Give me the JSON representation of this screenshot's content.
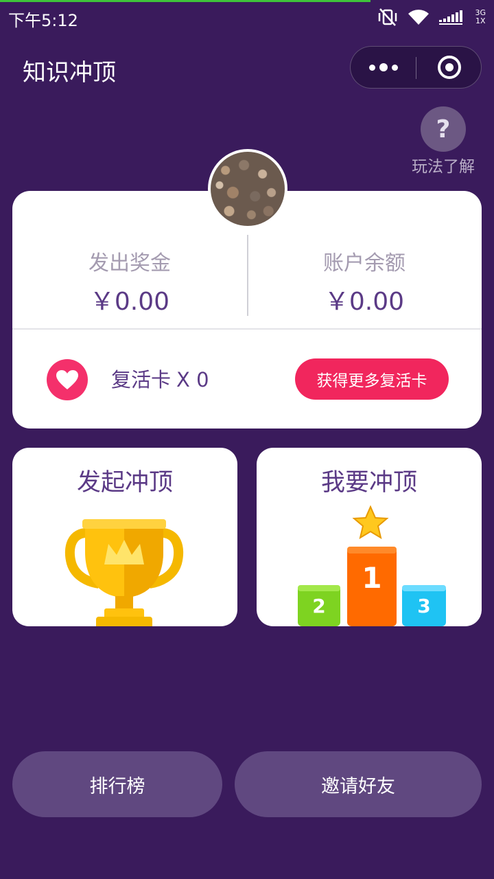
{
  "status_bar": {
    "time": "下午5:12",
    "network_top": "3G",
    "network_bottom": "1X"
  },
  "nav": {
    "title": "知识冲顶"
  },
  "help": {
    "label": "玩法了解"
  },
  "stats": {
    "left_label": "发出奖金",
    "left_value": "￥0.00",
    "right_label": "账户余额",
    "right_value": "￥0.00"
  },
  "revive": {
    "label": "复活卡",
    "count": "X 0",
    "button": "获得更多复活卡"
  },
  "cards": {
    "launch_title": "发起冲顶",
    "join_title": "我要冲顶",
    "podium_labels": [
      "1",
      "2",
      "3"
    ]
  },
  "bottom": {
    "rank_label": "排行榜",
    "invite_label": "邀请好友"
  },
  "colors": {
    "background": "#3a1b5c",
    "accent_purple": "#5b3a86",
    "accent_pink": "#f1265d",
    "button_purple": "#604880"
  }
}
